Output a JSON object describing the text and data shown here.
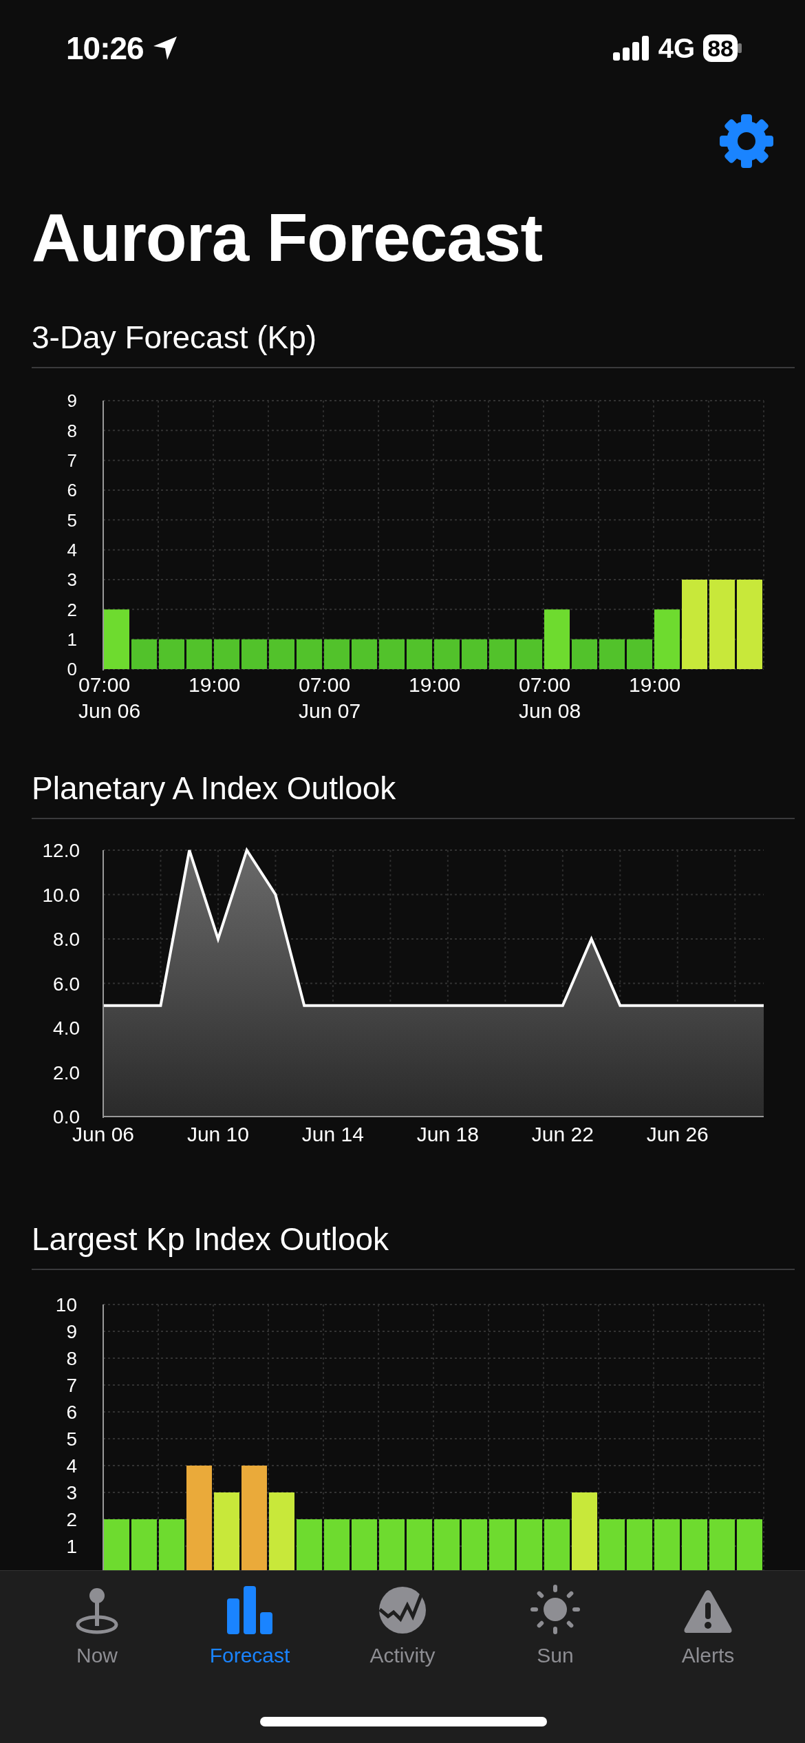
{
  "status_bar": {
    "time": "10:26",
    "network": "4G",
    "battery": "88"
  },
  "title": "Aurora Forecast",
  "sections": [
    {
      "title": "3-Day Forecast (Kp)",
      "chart_data": {
        "type": "bar",
        "grid": true,
        "ylim": [
          0,
          9
        ],
        "yticks": [
          0,
          1,
          2,
          3,
          4,
          5,
          6,
          7,
          8,
          9
        ],
        "categories": [
          "07:00\nJun 06",
          null,
          null,
          null,
          "19:00",
          null,
          null,
          null,
          "07:00\nJun 07",
          null,
          null,
          null,
          "19:00",
          null,
          null,
          null,
          "07:00\nJun 08",
          null,
          null,
          null,
          "19:00",
          null,
          null,
          null
        ],
        "series": [
          {
            "color": "#52c22b",
            "values": [
              null,
              1,
              1,
              1,
              1,
              1,
              1,
              1,
              1,
              1,
              1,
              1,
              1,
              1,
              1,
              1,
              null,
              1,
              1,
              1,
              null,
              null,
              null,
              null
            ]
          },
          {
            "color": "#6edb2f",
            "values": [
              2,
              null,
              null,
              null,
              null,
              null,
              null,
              null,
              null,
              null,
              null,
              null,
              null,
              null,
              null,
              null,
              2,
              null,
              null,
              null,
              2,
              null,
              null,
              null
            ]
          },
          {
            "color": "#c8e83a",
            "values": [
              null,
              null,
              null,
              null,
              null,
              null,
              null,
              null,
              null,
              null,
              null,
              null,
              null,
              null,
              null,
              null,
              null,
              null,
              null,
              null,
              null,
              3,
              3,
              3
            ]
          }
        ]
      }
    },
    {
      "title": "Planetary A Index Outlook",
      "chart_data": {
        "type": "area",
        "grid": true,
        "ylim": [
          0,
          12
        ],
        "yticks": [
          {
            "value": 0,
            "label": "0.0"
          },
          {
            "value": 2,
            "label": "2.0"
          },
          {
            "value": 4,
            "label": "4.0"
          },
          {
            "value": 6,
            "label": "6.0"
          },
          {
            "value": 8,
            "label": "8.0"
          },
          {
            "value": 10,
            "label": "10.0"
          },
          {
            "value": 12,
            "label": "12.0"
          }
        ],
        "categories": [
          "Jun 06",
          null,
          null,
          null,
          "Jun 10",
          null,
          null,
          null,
          "Jun 14",
          null,
          null,
          null,
          "Jun 18",
          null,
          null,
          null,
          "Jun 22",
          null,
          null,
          null,
          "Jun 26",
          null,
          null,
          null
        ],
        "series": [
          {
            "color": "#ffffff",
            "values": [
              5,
              5,
              5,
              12,
              8,
              12,
              10,
              5,
              5,
              5,
              5,
              5,
              5,
              5,
              5,
              5,
              5,
              8,
              5,
              5,
              5,
              5,
              5,
              5
            ]
          }
        ]
      }
    },
    {
      "title": "Largest Kp Index Outlook",
      "chart_data": {
        "type": "bar",
        "grid": true,
        "ylim": [
          0,
          10
        ],
        "yticks": [
          1,
          2,
          3,
          4,
          5,
          6,
          7,
          8,
          9,
          10
        ],
        "series": [
          {
            "color": "#6edb2f",
            "values": [
              2,
              2,
              2,
              null,
              null,
              null,
              null,
              2,
              2,
              2,
              2,
              2,
              2,
              2,
              2,
              2,
              2,
              null,
              2,
              2,
              2,
              2,
              2,
              2
            ]
          },
          {
            "color": "#c8e83a",
            "values": [
              null,
              null,
              null,
              null,
              3,
              null,
              3,
              null,
              null,
              null,
              null,
              null,
              null,
              null,
              null,
              null,
              null,
              3,
              null,
              null,
              null,
              null,
              null,
              null
            ]
          },
          {
            "color": "#eaaa3a",
            "values": [
              null,
              null,
              null,
              4,
              null,
              4,
              null,
              null,
              null,
              null,
              null,
              null,
              null,
              null,
              null,
              null,
              null,
              null,
              null,
              null,
              null,
              null,
              null,
              null
            ]
          }
        ]
      }
    }
  ],
  "tabs": [
    {
      "label": "Now",
      "selected": false
    },
    {
      "label": "Forecast",
      "selected": true
    },
    {
      "label": "Activity",
      "selected": false
    },
    {
      "label": "Sun",
      "selected": false
    },
    {
      "label": "Alerts",
      "selected": false
    }
  ]
}
